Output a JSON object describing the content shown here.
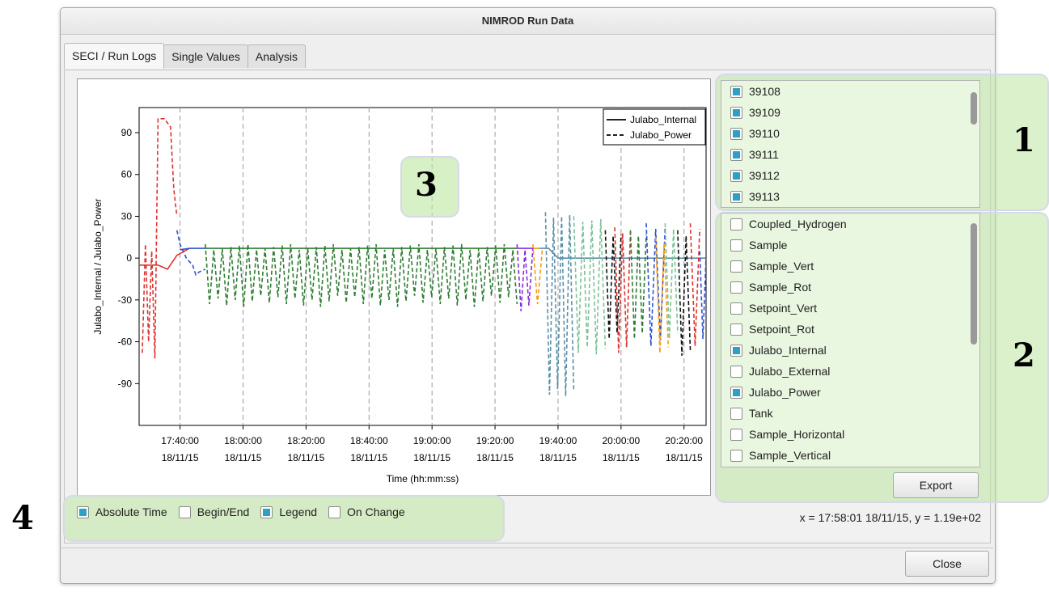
{
  "window": {
    "title": "NIMROD Run Data"
  },
  "tabs": [
    {
      "label": "SECI / Run Logs",
      "active": true
    },
    {
      "label": "Single Values",
      "active": false
    },
    {
      "label": "Analysis",
      "active": false
    }
  ],
  "runs": [
    {
      "label": "39108",
      "checked": true
    },
    {
      "label": "39109",
      "checked": true
    },
    {
      "label": "39110",
      "checked": true
    },
    {
      "label": "39111",
      "checked": true
    },
    {
      "label": "39112",
      "checked": true
    },
    {
      "label": "39113",
      "checked": true
    }
  ],
  "logs": [
    {
      "label": "Coupled_Hydrogen",
      "checked": false
    },
    {
      "label": "Sample",
      "checked": false
    },
    {
      "label": "Sample_Vert",
      "checked": false
    },
    {
      "label": "Sample_Rot",
      "checked": false
    },
    {
      "label": "Setpoint_Vert",
      "checked": false
    },
    {
      "label": "Setpoint_Rot",
      "checked": false
    },
    {
      "label": "Julabo_Internal",
      "checked": true
    },
    {
      "label": "Julabo_External",
      "checked": false
    },
    {
      "label": "Julabo_Power",
      "checked": true
    },
    {
      "label": "Tank",
      "checked": false
    },
    {
      "label": "Sample_Horizontal",
      "checked": false
    },
    {
      "label": "Sample_Vertical",
      "checked": false
    }
  ],
  "buttons": {
    "export": "Export",
    "close": "Close"
  },
  "options": {
    "absolute_time": {
      "label": "Absolute Time",
      "checked": true
    },
    "begin_end": {
      "label": "Begin/End",
      "checked": false
    },
    "legend": {
      "label": "Legend",
      "checked": true
    },
    "on_change": {
      "label": "On Change",
      "checked": false
    }
  },
  "status": {
    "coords": "x = 17:58:01 18/11/15, y = 1.19e+02"
  },
  "callouts": {
    "one": "1",
    "two": "2",
    "three": "3",
    "four": "4"
  },
  "chart_data": {
    "type": "line",
    "xlabel": "Time (hh:mm:ss)",
    "ylabel": "Julabo_Internal / Julabo_Power",
    "ylim": [
      -120,
      108
    ],
    "yticks": [
      90,
      60,
      30,
      0,
      -30,
      -60,
      -90
    ],
    "xticks": [
      {
        "time": "17:40:00",
        "date": "18/11/15"
      },
      {
        "time": "18:00:00",
        "date": "18/11/15"
      },
      {
        "time": "18:20:00",
        "date": "18/11/15"
      },
      {
        "time": "18:40:00",
        "date": "18/11/15"
      },
      {
        "time": "19:00:00",
        "date": "18/11/15"
      },
      {
        "time": "19:20:00",
        "date": "18/11/15"
      },
      {
        "time": "19:40:00",
        "date": "18/11/15"
      },
      {
        "time": "20:00:00",
        "date": "18/11/15"
      },
      {
        "time": "20:20:00",
        "date": "18/11/15"
      }
    ],
    "xlim": [
      "17:27:00",
      "20:27:00"
    ],
    "grid_x": true,
    "legend_position": "top-right",
    "legend": [
      {
        "name": "Julabo_Internal",
        "style": "solid"
      },
      {
        "name": "Julabo_Power",
        "style": "dashed"
      }
    ],
    "series": [
      {
        "name": "Julabo_Internal",
        "style": "solid",
        "color": "#e03030",
        "x": [
          "17:27:00",
          "17:33:00",
          "17:36:00",
          "17:39:00",
          "17:43:00"
        ],
        "y": [
          -5,
          -5,
          -8,
          2,
          7
        ]
      },
      {
        "name": "Julabo_Internal",
        "style": "solid",
        "color": "#3050d0",
        "x": [
          "17:40:00",
          "17:43:00",
          "17:48:00"
        ],
        "y": [
          6,
          7,
          7
        ]
      },
      {
        "name": "Julabo_Internal",
        "style": "solid",
        "color": "#2e7d32",
        "x": [
          "17:48:00",
          "19:27:00"
        ],
        "y": [
          7,
          7
        ]
      },
      {
        "name": "Julabo_Internal",
        "style": "solid",
        "color": "#8a2be2",
        "x": [
          "19:27:00",
          "19:32:00"
        ],
        "y": [
          7,
          7
        ]
      },
      {
        "name": "Julabo_Internal",
        "style": "solid",
        "color": "#f39c12",
        "x": [
          "19:32:00",
          "19:34:00"
        ],
        "y": [
          7,
          7
        ]
      },
      {
        "name": "Julabo_Internal",
        "style": "solid",
        "color": "#5a8fa8",
        "x": [
          "19:34:00",
          "19:37:00",
          "19:40:00",
          "20:27:00"
        ],
        "y": [
          7,
          7,
          0,
          0
        ]
      },
      {
        "name": "Julabo_Power",
        "style": "dashed",
        "color": "#e03030",
        "x": [
          "17:28:00",
          "17:29:00",
          "17:30:00",
          "17:31:00",
          "17:32:00",
          "17:33:00",
          "17:34:00",
          "17:35:00",
          "17:37:00",
          "17:38:00",
          "17:39:00"
        ],
        "y": [
          -68,
          10,
          -60,
          5,
          -72,
          100,
          100,
          100,
          94,
          50,
          30
        ]
      },
      {
        "name": "Julabo_Power",
        "style": "dashed",
        "color": "#3050d0",
        "x": [
          "17:39:00",
          "17:40:00",
          "17:42:00",
          "17:44:00",
          "17:45:00",
          "17:46:00",
          "17:48:00"
        ],
        "y": [
          20,
          10,
          0,
          -5,
          -12,
          -10,
          -8
        ]
      },
      {
        "name": "Julabo_Power",
        "style": "dashed",
        "color": "#2e7d32",
        "x_range": [
          "17:48:00",
          "19:27:00"
        ],
        "y_range": [
          -35,
          10
        ],
        "pattern": "oscillating"
      },
      {
        "name": "Julabo_Power",
        "style": "dashed",
        "color": "#8a2be2",
        "x_range": [
          "19:27:00",
          "19:32:00"
        ],
        "y_range": [
          -40,
          10
        ],
        "pattern": "oscillating"
      },
      {
        "name": "Julabo_Power",
        "style": "dashed",
        "color": "#f39c12",
        "x_range": [
          "19:32:00",
          "19:35:00"
        ],
        "y_range": [
          -35,
          10
        ],
        "pattern": "oscillating"
      },
      {
        "name": "Julabo_Power",
        "style": "dashed",
        "color": "#5a8fa8",
        "x_range": [
          "19:36:00",
          "19:45:00"
        ],
        "y_range": [
          -100,
          33
        ],
        "pattern": "oscillating"
      },
      {
        "name": "Julabo_Power",
        "style": "dashed",
        "color": "#7cc197",
        "x_range": [
          "19:45:00",
          "19:55:00"
        ],
        "y_range": [
          -70,
          30
        ],
        "pattern": "oscillating"
      },
      {
        "name": "Julabo_Power",
        "style": "dashed",
        "color": "#111111",
        "x_range": [
          "19:55:00",
          "20:00:00"
        ],
        "y_range": [
          -60,
          20
        ],
        "pattern": "oscillating"
      },
      {
        "name": "Julabo_Power",
        "style": "dashed",
        "color": "#e03030",
        "x_range": [
          "19:58:00",
          "20:03:00"
        ],
        "y_range": [
          -70,
          22
        ],
        "pattern": "oscillating"
      },
      {
        "name": "Julabo_Power",
        "style": "dashed",
        "color": "#2e7d32",
        "x_range": [
          "20:03:00",
          "20:08:00"
        ],
        "y_range": [
          -60,
          20
        ],
        "pattern": "oscillating"
      },
      {
        "name": "Julabo_Power",
        "style": "dashed",
        "color": "#3050d0",
        "x_range": [
          "20:08:00",
          "20:14:00"
        ],
        "y_range": [
          -65,
          25
        ],
        "pattern": "oscillating"
      },
      {
        "name": "Julabo_Power",
        "style": "dashed",
        "color": "#f39c12",
        "x_range": [
          "20:11:00",
          "20:15:00"
        ],
        "y_range": [
          -70,
          15
        ],
        "pattern": "oscillating"
      },
      {
        "name": "Julabo_Power",
        "style": "dashed",
        "color": "#7cc197",
        "x_range": [
          "20:14:00",
          "20:18:00"
        ],
        "y_range": [
          -60,
          25
        ],
        "pattern": "oscillating"
      },
      {
        "name": "Julabo_Power",
        "style": "dashed",
        "color": "#111111",
        "x_range": [
          "20:18:00",
          "20:22:00"
        ],
        "y_range": [
          -72,
          20
        ],
        "pattern": "oscillating"
      },
      {
        "name": "Julabo_Power",
        "style": "dashed",
        "color": "#e03030",
        "x_range": [
          "20:22:00",
          "20:25:00"
        ],
        "y_range": [
          -65,
          25
        ],
        "pattern": "oscillating"
      },
      {
        "name": "Julabo_Power",
        "style": "dashed",
        "color": "#3050d0",
        "x_range": [
          "20:25:00",
          "20:27:00"
        ],
        "y_range": [
          -60,
          5
        ],
        "pattern": "oscillating"
      }
    ]
  }
}
